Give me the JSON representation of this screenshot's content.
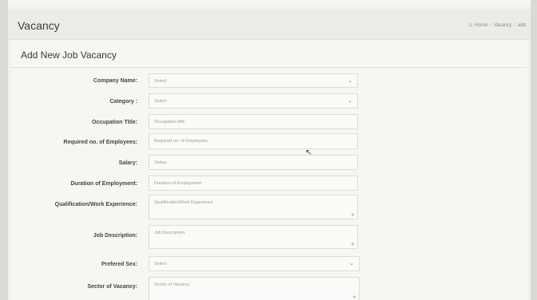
{
  "header": {
    "title": "Vacancy",
    "breadcrumb": [
      "Home",
      "Vacancy",
      "add"
    ]
  },
  "form": {
    "title": "Add New Job Vacancy",
    "fields": [
      {
        "label": "Company Name:",
        "placeholder": "Select",
        "type": "select"
      },
      {
        "label": "Category :",
        "placeholder": "Select",
        "type": "select"
      },
      {
        "label": "Occupation Title:",
        "placeholder": "Occupation title",
        "type": "input"
      },
      {
        "label": "Required no. of Employees:",
        "placeholder": "Required no. of Employees",
        "type": "input"
      },
      {
        "label": "Salary:",
        "placeholder": "Salary",
        "type": "input"
      },
      {
        "label": "Duration of Employment:",
        "placeholder": "Duration of Employment",
        "type": "input"
      },
      {
        "label": "Qualification/Work Experience:",
        "placeholder": "Qualification/Work Experience",
        "type": "textarea"
      },
      {
        "label": "Job Description:",
        "placeholder": "Job Description",
        "type": "textarea"
      },
      {
        "label": "Prefered Sex:",
        "placeholder": "Select",
        "type": "select"
      },
      {
        "label": "Sector of Vacancy:",
        "placeholder": "Sector of Vacancy",
        "type": "textarea"
      }
    ]
  },
  "icons": {
    "home": "home-icon",
    "select_arrow": "chevron-down-icon",
    "resize": "resize-handle-icon",
    "cursor": "mouse-cursor-icon"
  }
}
